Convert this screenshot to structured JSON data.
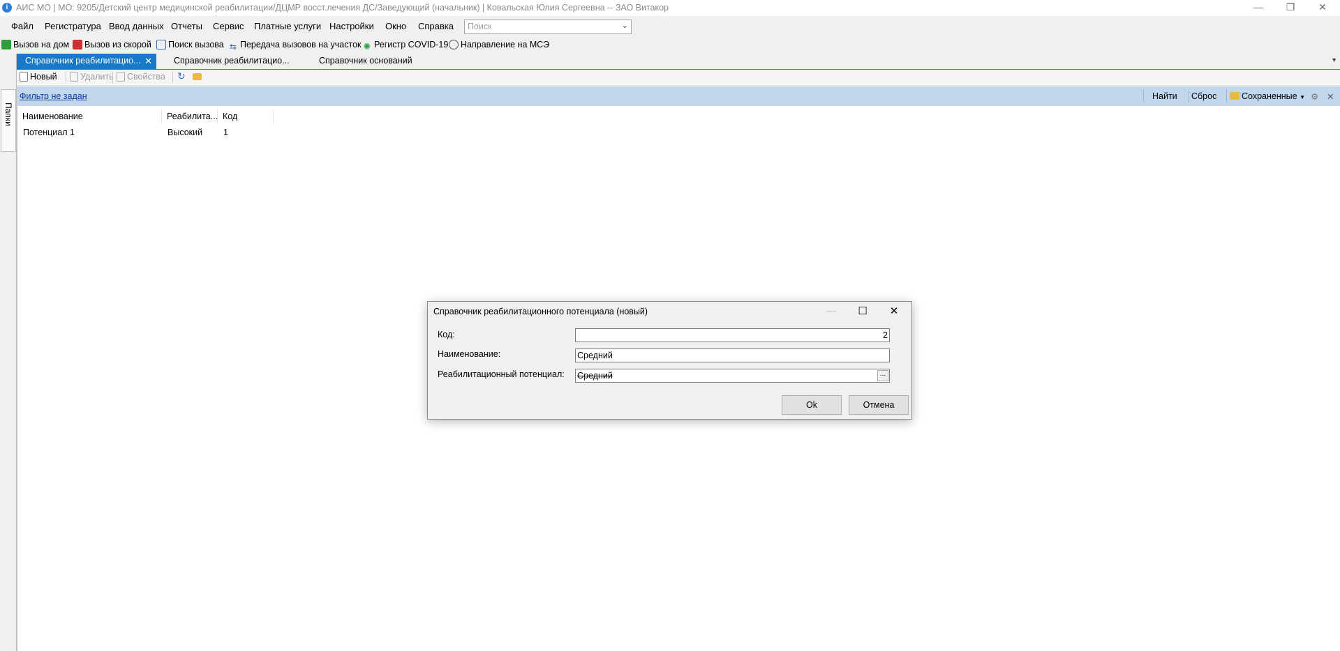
{
  "window": {
    "title": "АИС МО | МО: 9205/Детский центр медицинской реабилитации/ДЦМР восст.лечения ДС/Заведующий (начальник) | Ковальская Юлия Сергеевна -- ЗАО Витакор",
    "controls": {
      "minimize": "—",
      "restore": "❐",
      "close": "✕"
    }
  },
  "menu": {
    "items": [
      "Файл",
      "Регистратура",
      "Ввод данных",
      "Отчеты",
      "Сервис",
      "Платные услуги",
      "Настройки",
      "Окно",
      "Справка"
    ],
    "search_placeholder": "Поиск"
  },
  "quickbar": {
    "items": [
      {
        "label": "Вызов на дом",
        "icon": "green-check-icon",
        "color": "#2e9e3a"
      },
      {
        "label": "Вызов из скорой",
        "icon": "red-check-icon",
        "color": "#d03030"
      },
      {
        "label": "Поиск вызова",
        "icon": "search-call-icon",
        "color": "#3a6fb0"
      },
      {
        "label": "Передача вызовов на участок",
        "icon": "transfer-icon",
        "color": "#3a6fb0"
      },
      {
        "label": "Регистр COVID-19",
        "icon": "virus-icon",
        "color": "#2e9e3a"
      },
      {
        "label": "Направление на МСЭ",
        "icon": "referral-icon",
        "color": "#555555"
      }
    ]
  },
  "left_panel": {
    "folders_label": "Папки"
  },
  "tabs": [
    {
      "label": "Справочник реабилитацио...",
      "active": true,
      "close": "✕"
    },
    {
      "label": "Справочник реабилитацио...",
      "active": false
    },
    {
      "label": "Справочник оснований",
      "active": false
    }
  ],
  "toolbar": {
    "new": "Новый",
    "delete": "Удалить",
    "properties": "Свойства"
  },
  "filter": {
    "link": "Фильтр не задан",
    "find": "Найти",
    "reset": "Сброс",
    "saved": "Сохраненные"
  },
  "grid": {
    "columns": [
      "Наименование",
      "Реабилита...",
      "Код"
    ],
    "rows": [
      [
        "Потенциал 1",
        "Высокий",
        "1"
      ]
    ]
  },
  "dialog": {
    "title": "Справочник реабилитационного потенциала (новый)",
    "fields": {
      "code_label": "Код:",
      "code_value": "2",
      "name_label": "Наименование:",
      "name_value": "Средний",
      "rehab_label": "Реабилитационный потенциал:",
      "rehab_value": "Средний"
    },
    "ok": "Ok",
    "cancel": "Отмена",
    "ellipsis": "..."
  },
  "colors": {
    "accent": "#1979c9",
    "filter_bar": "#c2d7ee",
    "link": "#0b3e9c"
  }
}
